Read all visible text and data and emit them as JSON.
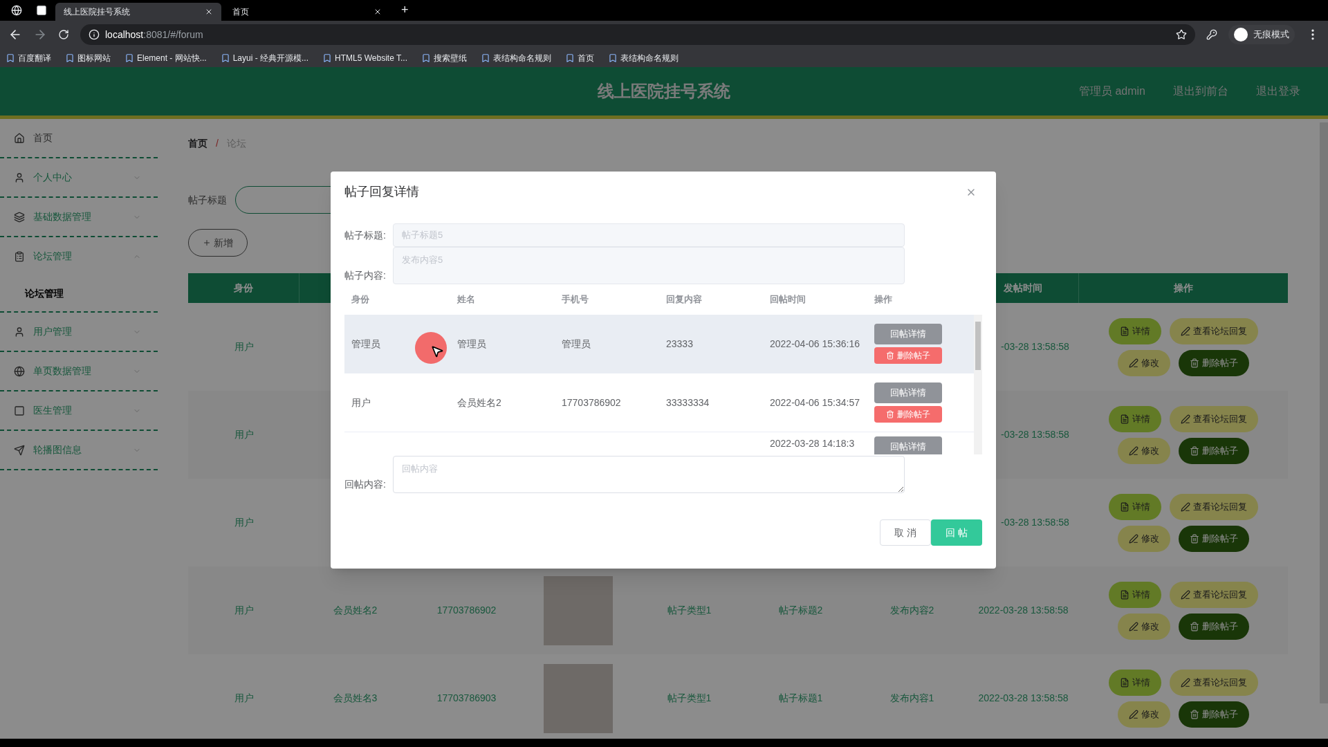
{
  "browser": {
    "tabs": [
      {
        "title": "线上医院挂号系统",
        "selected": true
      },
      {
        "title": "首页",
        "selected": false
      }
    ],
    "new_tab": "+",
    "address": {
      "host": "localhost",
      "path": ":8081/#/forum"
    },
    "profile": "无痕模式",
    "bookmarks": [
      {
        "label": "百度翻译"
      },
      {
        "label": "图标网站"
      },
      {
        "label": "Element - 网站快..."
      },
      {
        "label": "Layui - 经典开源模..."
      },
      {
        "label": "HTML5 Website T..."
      },
      {
        "label": "搜索壁纸"
      },
      {
        "label": "表结构命名规则"
      },
      {
        "label": "首页"
      },
      {
        "label": "表结构命名规则"
      }
    ]
  },
  "header": {
    "title": "线上医院挂号系统",
    "links": [
      "管理员 admin",
      "退出到前台",
      "退出登录"
    ]
  },
  "sidebar": {
    "items": [
      {
        "label": "首页",
        "kind": "link"
      },
      {
        "label": "个人中心",
        "kind": "menu",
        "expanded": false
      },
      {
        "label": "基础数据管理",
        "kind": "menu",
        "expanded": false
      },
      {
        "label": "论坛管理",
        "kind": "menu",
        "expanded": true,
        "children": [
          {
            "label": "论坛管理",
            "selected": true
          }
        ]
      },
      {
        "label": "用户管理",
        "kind": "menu",
        "expanded": false
      },
      {
        "label": "单页数据管理",
        "kind": "menu",
        "expanded": false
      },
      {
        "label": "医生管理",
        "kind": "menu",
        "expanded": false
      },
      {
        "label": "轮播图信息",
        "kind": "menu",
        "expanded": false
      }
    ]
  },
  "breadcrumb": {
    "items": [
      "首页",
      "论坛"
    ],
    "separator": "/"
  },
  "search": {
    "label": "帖子标题"
  },
  "add_button": "新增",
  "table": {
    "columns": {
      "identity": "身份",
      "time": "发帖时间",
      "actions": "操作"
    },
    "rows": [
      {
        "identity": "用户",
        "time": "-03-28 13:58:58",
        "actions": [
          "详情",
          "查看论坛回复",
          "修改",
          "删除帖子"
        ]
      },
      {
        "identity": "用户",
        "time": "-03-28 13:58:58",
        "actions": [
          "详情",
          "查看论坛回复",
          "修改",
          "删除帖子"
        ]
      },
      {
        "identity": "用户",
        "time": "-03-28 13:58:58",
        "actions": [
          "详情",
          "查看论坛回复",
          "修改",
          "删除帖子"
        ]
      },
      {
        "identity": "用户",
        "name": "会员姓名2",
        "phone": "17703786902",
        "type": "帖子类型1",
        "title": "帖子标题2",
        "content": "发布内容2",
        "time": "2022-03-28 13:58:58",
        "actions": [
          "详情",
          "查看论坛回复",
          "修改",
          "删除帖子"
        ]
      },
      {
        "identity": "用户",
        "name": "会员姓名3",
        "phone": "17703786903",
        "type": "帖子类型1",
        "title": "帖子标题1",
        "content": "发布内容1",
        "time": "2022-03-28 13:58:58",
        "actions": [
          "详情",
          "查看论坛回复",
          "修改",
          "删除帖子"
        ]
      }
    ]
  },
  "dialog": {
    "title": "帖子回复详情",
    "post_title": {
      "label": "帖子标题:",
      "value": "帖子标题5"
    },
    "post_content": {
      "label": "帖子内容:",
      "value": "发布内容5"
    },
    "replies": {
      "columns": [
        "身份",
        "姓名",
        "手机号",
        "回复内容",
        "回帖时间",
        "操作"
      ],
      "rows": [
        {
          "highlighted": true,
          "identity": "管理员",
          "name": "管理员",
          "phone": "管理员",
          "content": "23333",
          "time": "2022-04-06 15:36:16",
          "actions": [
            {
              "label": "回帖详情",
              "kind": "detail"
            },
            {
              "label": "删除帖子",
              "kind": "delete"
            }
          ]
        },
        {
          "highlighted": false,
          "identity": "用户",
          "name": "会员姓名2",
          "phone": "17703786902",
          "content": "33333334",
          "time": "2022-04-06 15:34:57",
          "actions": [
            {
              "label": "回帖详情",
              "kind": "detail"
            },
            {
              "label": "删除帖子",
              "kind": "delete"
            }
          ]
        },
        {
          "highlighted": false,
          "time": "2022-03-28 14:18:3",
          "actions": [
            {
              "label": "回帖详情",
              "kind": "detail"
            }
          ]
        }
      ]
    },
    "reply_field": {
      "label": "回帖内容:",
      "placeholder": "回帖内容"
    },
    "buttons": [
      {
        "label": "取 消",
        "kind": "default"
      },
      {
        "label": "回 帖",
        "kind": "primary"
      }
    ]
  }
}
